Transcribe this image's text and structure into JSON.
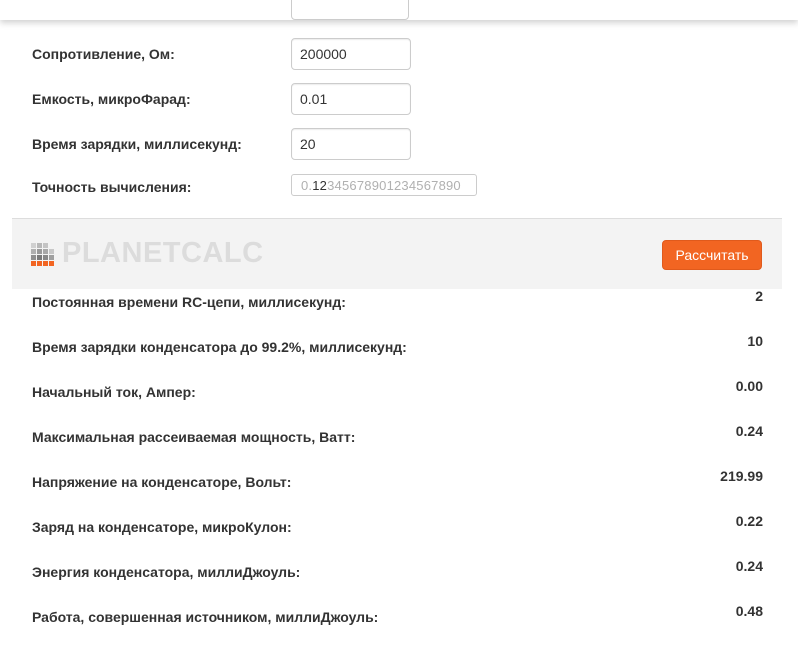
{
  "inputs": [
    {
      "label": "Сопротивление, Ом:",
      "value": "200000"
    },
    {
      "label": "Емкость, микроФарад:",
      "value": "0.01"
    },
    {
      "label": "Время зарядки, миллисекунд:",
      "value": "20"
    }
  ],
  "precision": {
    "label": "Точность вычисления:",
    "lead": "0.",
    "selected": "12",
    "rest": "345678901234567890"
  },
  "header": {
    "logo_text": "PLANETCALC",
    "calculate_label": "Рассчитать"
  },
  "results": [
    {
      "label": "Постоянная времени RC-цепи, миллисекунд:",
      "value": "2"
    },
    {
      "label": "Время зарядки конденсатора до 99.2%, миллисекунд:",
      "value": "10"
    },
    {
      "label": "Начальный ток, Ампер:",
      "value": "0.00"
    },
    {
      "label": "Максимальная рассеиваемая мощность, Ватт:",
      "value": "0.24"
    },
    {
      "label": "Напряжение на конденсаторе, Вольт:",
      "value": "219.99"
    },
    {
      "label": "Заряд на конденсаторе, микроКулон:",
      "value": "0.22"
    },
    {
      "label": "Энергия конденсатора, миллиДжоуль:",
      "value": "0.24"
    },
    {
      "label": "Работа, совершенная источником, миллиДжоуль:",
      "value": "0.48"
    }
  ],
  "colors": {
    "accent": "#f26522",
    "header_bg": "#f3f3f3",
    "logo_text": "#dcdcdc"
  }
}
